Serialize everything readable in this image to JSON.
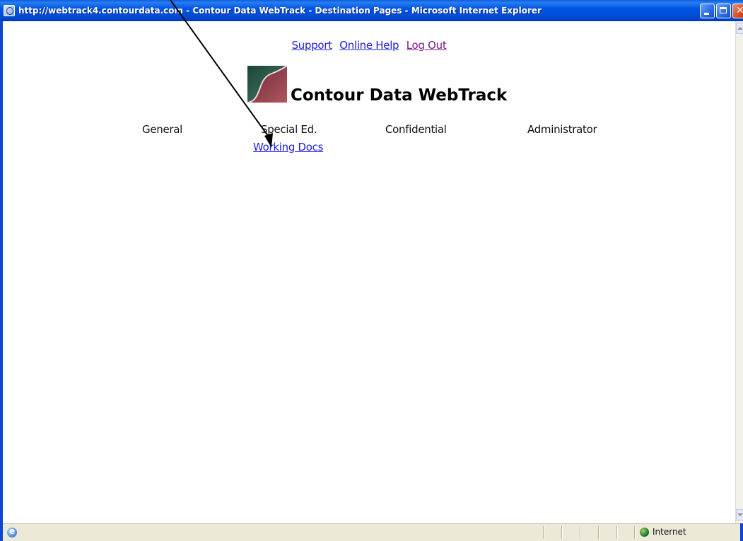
{
  "window": {
    "title": "http://webtrack4.contourdata.com - Contour Data WebTrack - Destination Pages - Microsoft Internet Explorer"
  },
  "header": {
    "links": {
      "support": "Support",
      "online_help": "Online Help",
      "log_out": "Log Out"
    },
    "brand": "Contour Data WebTrack"
  },
  "nav": {
    "items": [
      {
        "label": "General"
      },
      {
        "label": "Special Ed."
      },
      {
        "label": "Confidential"
      },
      {
        "label": "Administrator"
      }
    ],
    "sublinks": {
      "working_docs": "Working Docs"
    }
  },
  "statusbar": {
    "zone": "Internet"
  },
  "icons": {
    "window_icon": "ie-page-icon",
    "status_icon": "ie-icon",
    "zone_icon": "globe-icon",
    "annotation": "arrow-icon"
  },
  "colors": {
    "titlebar": "#0055e5",
    "link": "#2020e0",
    "visited_link": "#7a1a8a"
  }
}
